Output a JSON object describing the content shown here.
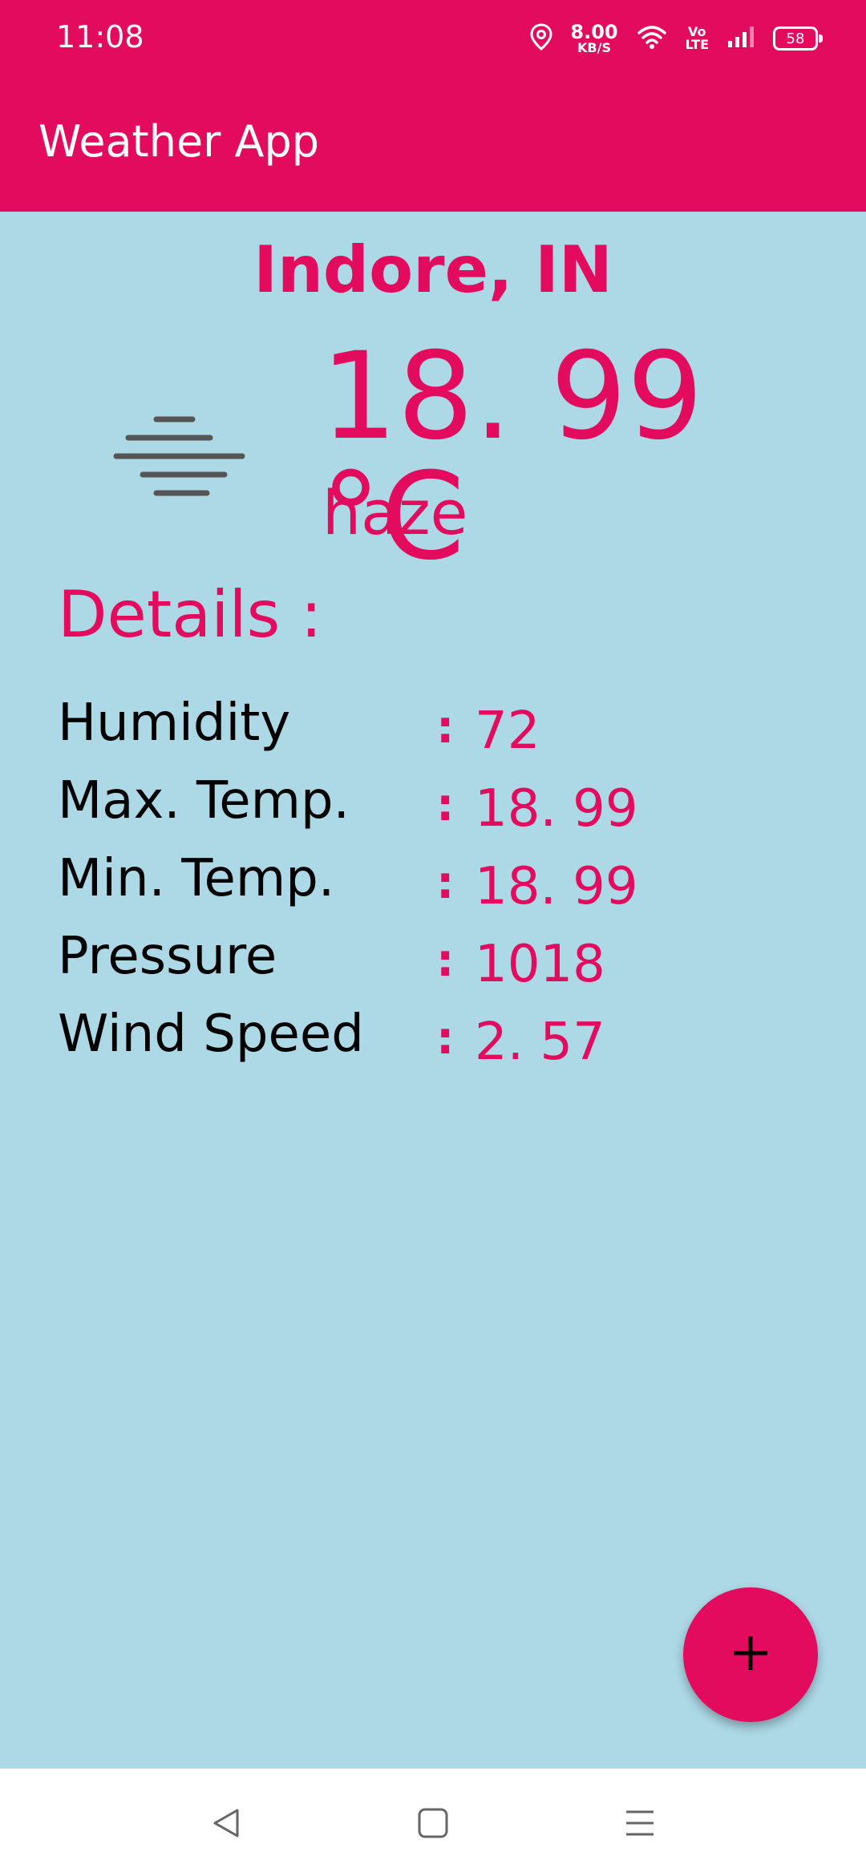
{
  "status_bar": {
    "time": "11:08",
    "net_speed_value": "8.00",
    "net_speed_unit": "KB/S",
    "volte_top": "Vo",
    "volte_bottom": "LTE",
    "battery": "58",
    "icons": [
      "location-icon",
      "wifi-icon",
      "signal-icon",
      "battery-icon"
    ]
  },
  "app_bar": {
    "title": "Weather App"
  },
  "weather": {
    "location": "Indore,  IN",
    "temperature": "18. 99 °C",
    "condition": "haze",
    "icon": "haze-icon"
  },
  "details": {
    "title": "Details :",
    "separator": ":",
    "rows": [
      {
        "label": "Humidity",
        "value": "72"
      },
      {
        "label": "Max.  Temp.",
        "value": "18. 99"
      },
      {
        "label": "Min.  Temp.",
        "value": "18. 99"
      },
      {
        "label": "Pressure",
        "value": "1018"
      },
      {
        "label": "Wind Speed",
        "value": "2. 57"
      }
    ]
  },
  "fab": {
    "icon": "plus-icon"
  },
  "nav_bar": {
    "icons": [
      "back-icon",
      "home-icon",
      "recents-icon"
    ]
  },
  "colors": {
    "primary": "#e30b5d",
    "background": "#add8e6",
    "label_text": "#000000",
    "nav_bar": "#ffffff"
  }
}
